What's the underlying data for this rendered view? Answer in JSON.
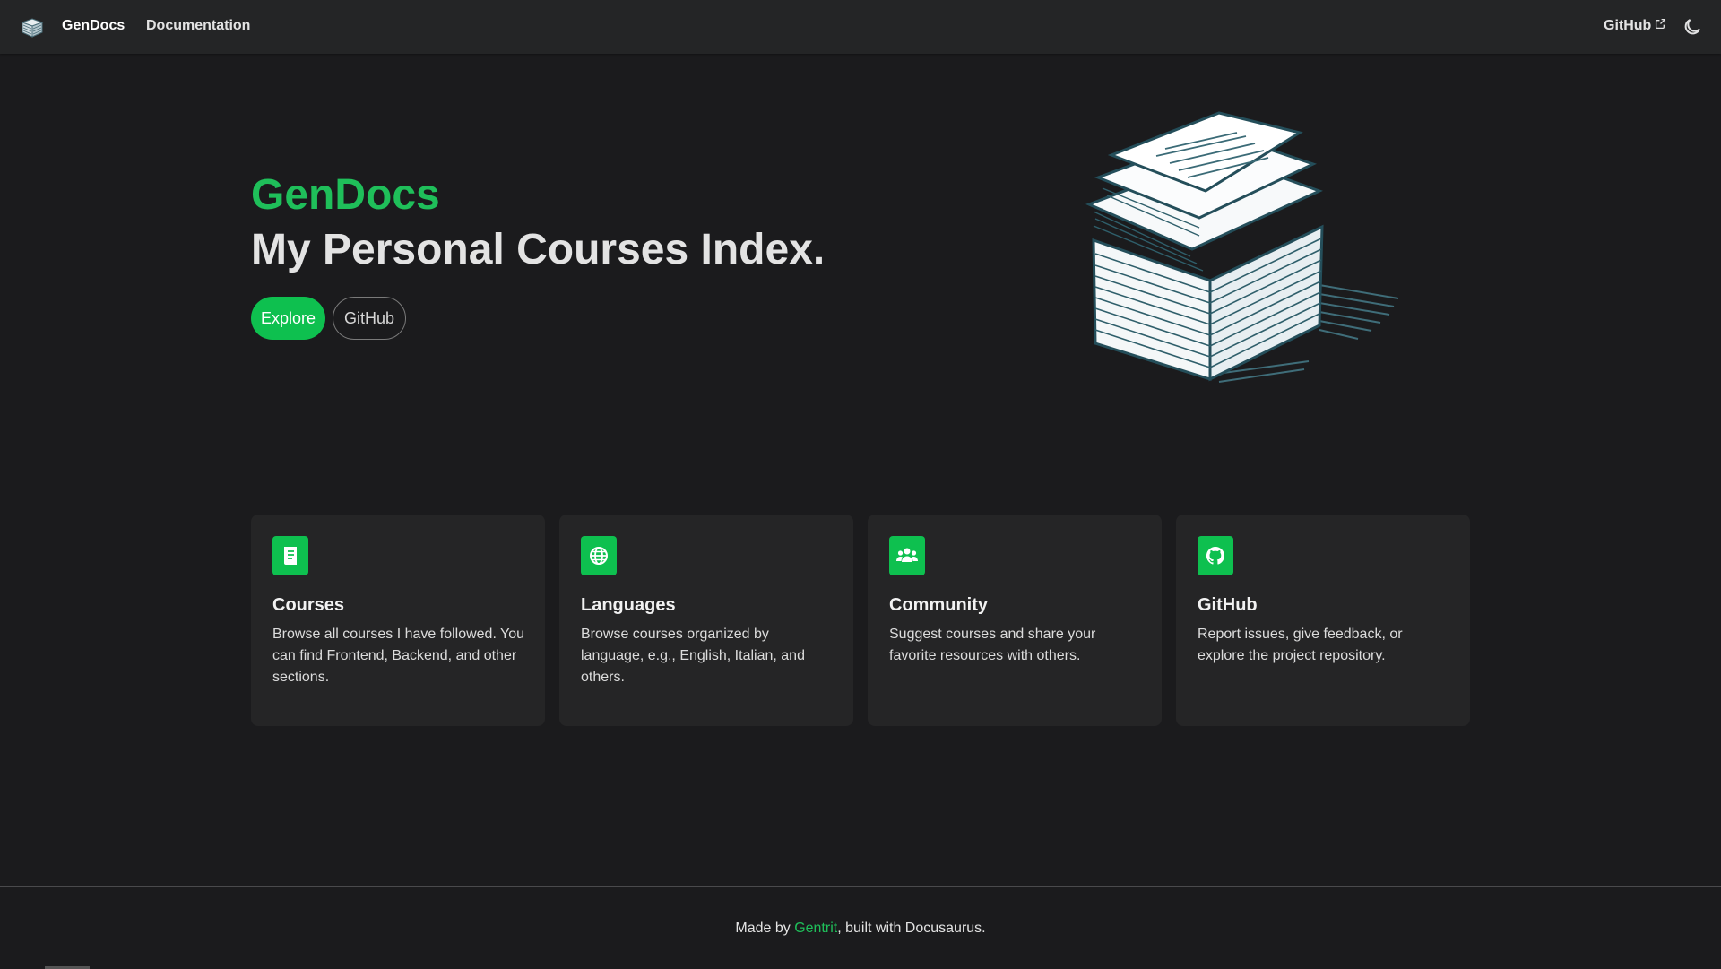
{
  "navbar": {
    "brand": "GenDocs",
    "links": [
      "Documentation"
    ],
    "github_label": "GitHub",
    "logo_icon": "paper-stack-icon",
    "theme_icon": "moon-icon"
  },
  "hero": {
    "title": "GenDocs",
    "subtitle": "My Personal Courses Index.",
    "primary_button": "Explore",
    "secondary_button": "GitHub",
    "illustration": "paper-stack-illustration"
  },
  "cards": [
    {
      "title": "Courses",
      "description": "Browse all courses I have followed. You can find Frontend, Backend, and other sections.",
      "icon": "book-icon"
    },
    {
      "title": "Languages",
      "description": "Browse courses organized by language, e.g., English, Italian, and others.",
      "icon": "globe-icon"
    },
    {
      "title": "Community",
      "description": "Suggest courses and share your favorite resources with others.",
      "icon": "users-icon"
    },
    {
      "title": "GitHub",
      "description": "Report issues, give feedback, or explore the project repository.",
      "icon": "github-icon"
    }
  ],
  "footer": {
    "prefix": "Made by ",
    "author": "Gentrit",
    "suffix": ", built with Docusaurus."
  },
  "colors": {
    "accent": "#0ec04f",
    "accent_text": "#1fbf5a",
    "background": "#1b1b1d",
    "navbar": "#242526",
    "card": "#252526"
  }
}
